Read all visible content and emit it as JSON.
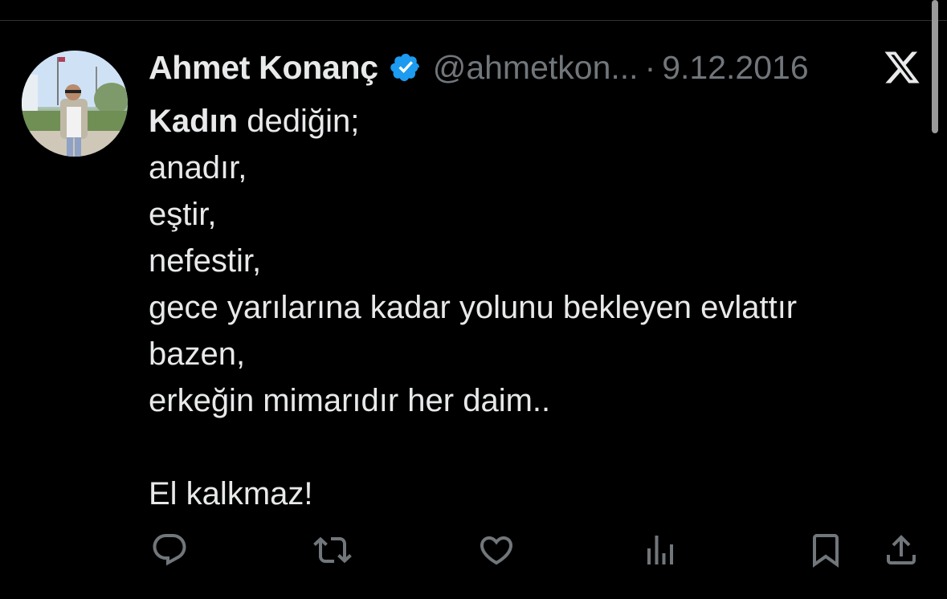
{
  "tweet": {
    "author": {
      "name": "Ahmet Konanç",
      "handle": "@ahmetkon...",
      "verified": true
    },
    "separator": "·",
    "date": "9.12.2016",
    "text": {
      "bold_word": "Kadın",
      "first_line_rest": " dediğin;",
      "body": "anadır,\neştir,\nnefestir,\ngece yarılarına kadar yolunu bekleyen evlattır\nbazen,\nerkeğin mimarıdır her daim..\n\nEl kalkmaz!"
    },
    "actions": [
      {
        "icon": "reply-icon"
      },
      {
        "icon": "retweet-icon"
      },
      {
        "icon": "like-icon"
      },
      {
        "icon": "views-icon"
      },
      {
        "icon": "bookmark-icon"
      },
      {
        "icon": "share-icon"
      }
    ]
  },
  "platform_logo": "x-logo",
  "colors": {
    "background": "#000000",
    "text": "#e7e9ea",
    "secondary": "#71767b",
    "verified": "#1d9bf0"
  }
}
